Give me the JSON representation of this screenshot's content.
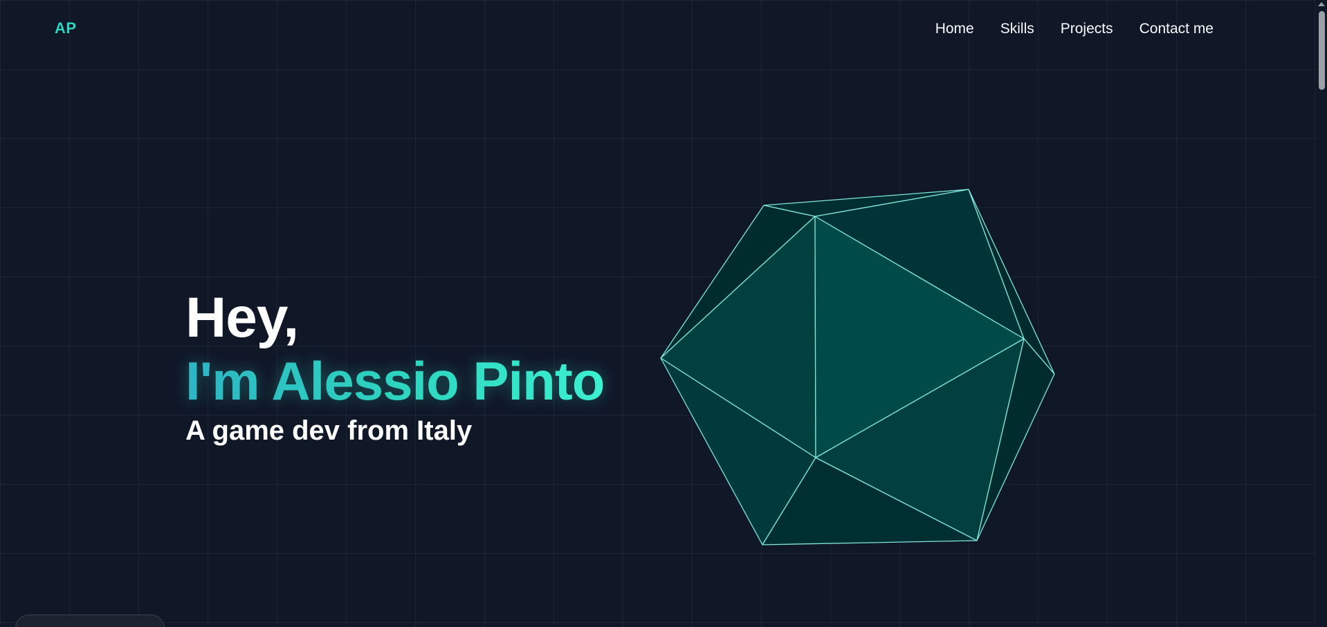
{
  "header": {
    "logo_text": "AP",
    "nav": [
      {
        "label": "Home"
      },
      {
        "label": "Skills"
      },
      {
        "label": "Projects"
      },
      {
        "label": "Contact me"
      }
    ]
  },
  "hero": {
    "greeting": "Hey,",
    "name": "I'm Alessio Pinto",
    "tagline": "A game dev from Italy"
  },
  "colors": {
    "background": "#101828",
    "accent": "#2dd4bf",
    "shape_stroke": "#7ee8dc",
    "shape_face_light": "#014a4a",
    "shape_face_dark": "#002c2e"
  }
}
